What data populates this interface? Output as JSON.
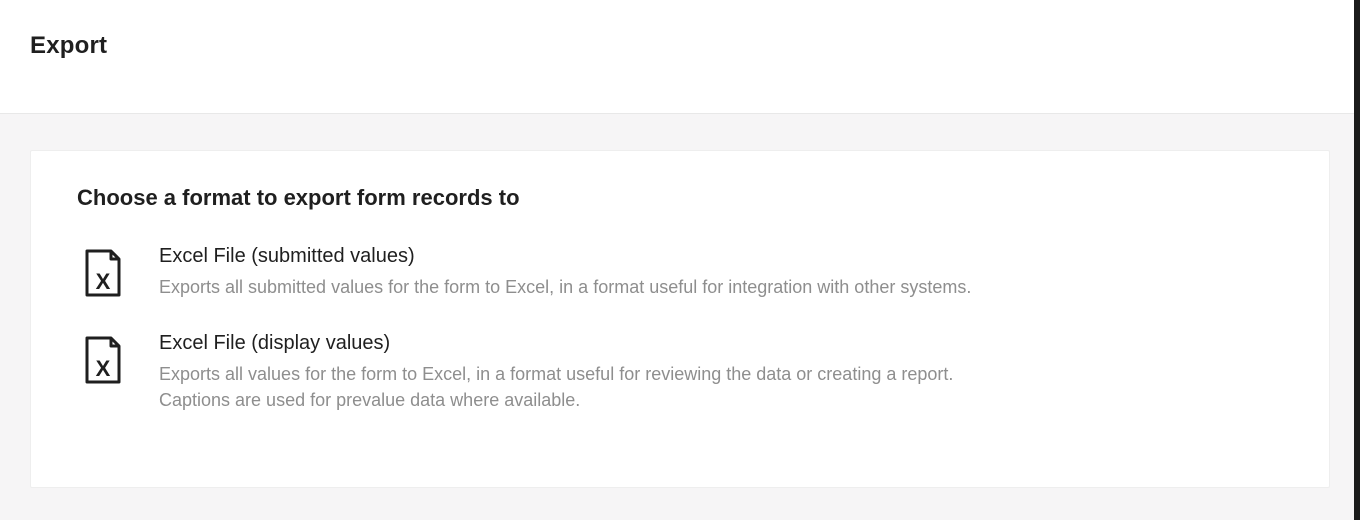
{
  "header": {
    "title": "Export"
  },
  "panel": {
    "heading": "Choose a format to export form records to",
    "options": [
      {
        "icon": "excel-file-icon",
        "title": "Excel File (submitted values)",
        "description": "Exports all submitted values for the form to Excel, in a format useful for integration with other systems."
      },
      {
        "icon": "excel-file-icon",
        "title": "Excel File (display values)",
        "description": "Exports all values for the form to Excel, in a format useful for reviewing the data or creating a report. Captions are used for prevalue data where available."
      }
    ]
  }
}
